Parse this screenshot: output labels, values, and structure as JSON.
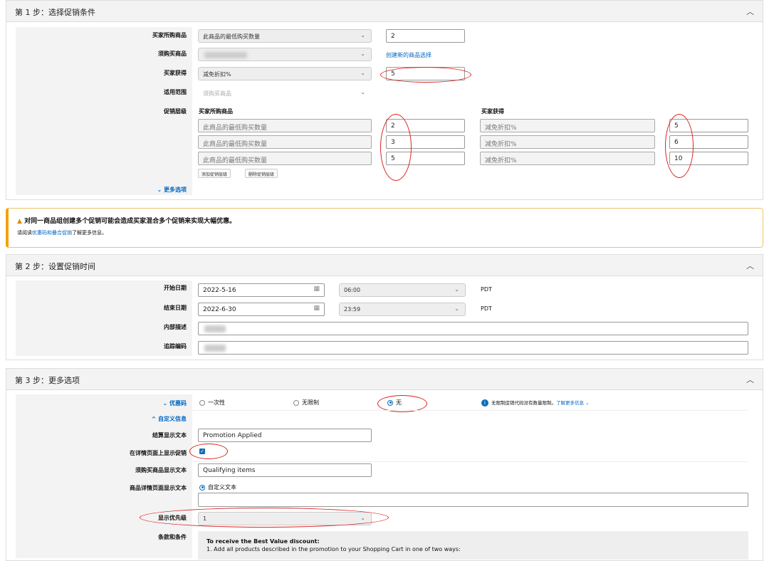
{
  "step1": {
    "title": "第 1 步：选择促销条件",
    "buyer_purchases_label": "买家所购商品",
    "buyer_purchases_value": "此商品的最低购买数量",
    "buyer_purchases_qty": "2",
    "required_items_label": "须购买商品",
    "create_selection_link": "创建新的商品选择",
    "buyer_gets_label": "买家获得",
    "buyer_gets_value": "减免折扣%",
    "buyer_gets_amount": "5",
    "applies_to_label": "适用范围",
    "applies_to_value": "须购买商品",
    "tiers_label": "促销层级",
    "tiers_col1": "买家所购商品",
    "tiers_col2": "买家获得",
    "tiers": [
      {
        "condition": "此商品的最低购买数量",
        "qty": "2",
        "benefit": "减免折扣%",
        "amount": "5"
      },
      {
        "condition": "此商品的最低购买数量",
        "qty": "3",
        "benefit": "减免折扣%",
        "amount": "6"
      },
      {
        "condition": "此商品的最低购买数量",
        "qty": "5",
        "benefit": "减免折扣%",
        "amount": "10"
      }
    ],
    "add_tier": "添加促销层级",
    "remove_tier": "删除促销层级",
    "more_options": "更多选项"
  },
  "warning": {
    "title": "对同一商品组创建多个促销可能会造成买家混合多个促销来实现大幅优惠。",
    "pre": "请阅读",
    "link": "优惠码和叠合促销",
    "post": "了解更多信息。"
  },
  "step2": {
    "title": "第 2 步：设置促销时间",
    "start_label": "开始日期",
    "start_date": "2022-5-16",
    "start_time": "06:00",
    "tz": "PDT",
    "end_label": "结束日期",
    "end_date": "2022-6-30",
    "end_time": "23:59",
    "internal_desc_label": "内部描述",
    "tracking_code_label": "追踪编码"
  },
  "step3": {
    "title": "第 3 步：更多选项",
    "coupon_label": "优惠码",
    "opt_once": "一次性",
    "opt_unlimited": "无限制",
    "opt_none": "无",
    "info_text": "无限制促销代码没有数量限制。",
    "info_link": "了解更多信息",
    "custom_msg_label": "自定义信息",
    "checkout_text_label": "结算显示文本",
    "checkout_text": "Promotion Applied",
    "show_on_detail_label": "在详情页面上显示促销",
    "qualifying_label": "须购买商品显示文本",
    "qualifying_text": "Qualifying items",
    "detail_text_label": "商品详情页面显示文本",
    "detail_custom": "自定义文本",
    "priority_label": "显示优先级",
    "priority_value": "1",
    "terms_label": "条款和条件",
    "terms_title": "To receive the Best Value discount:",
    "terms_line1": "1. Add all products described in the promotion to your Shopping Cart in one of two ways:"
  }
}
